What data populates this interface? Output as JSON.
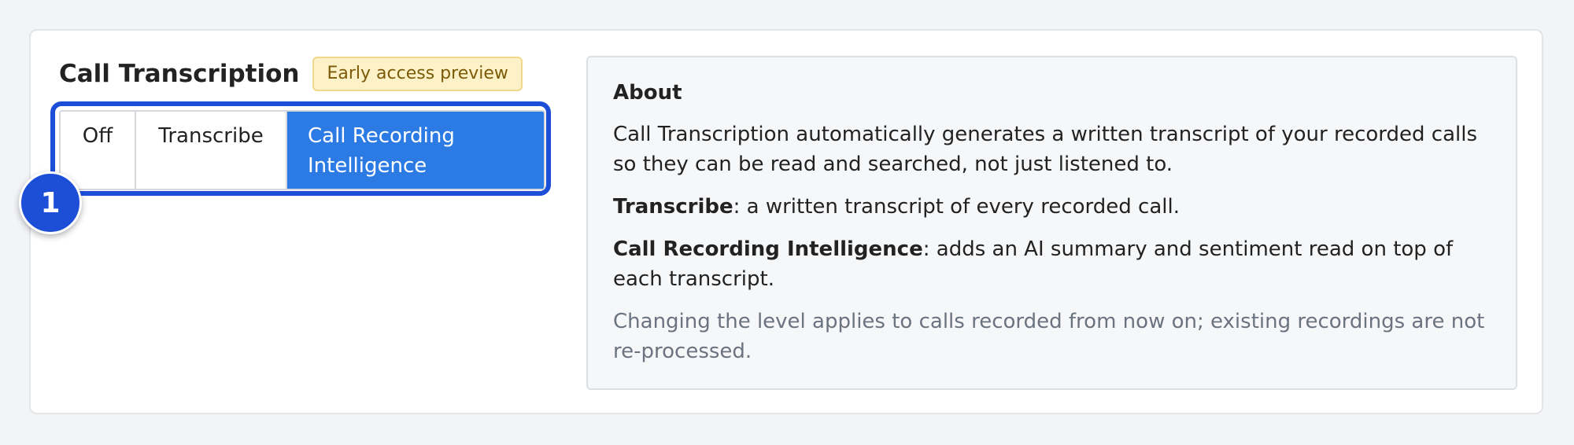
{
  "header": {
    "title": "Call Transcription",
    "badge": "Early access preview"
  },
  "segmented_control": {
    "options": [
      {
        "label": "Off",
        "selected": false
      },
      {
        "label": "Transcribe",
        "selected": false
      },
      {
        "label": "Call Recording Intelligence",
        "selected": true
      }
    ],
    "step_marker": "1"
  },
  "about": {
    "heading": "About",
    "intro": "Call Transcription automatically generates a written transcript of your recorded calls so they can be read and searched, not just listened to.",
    "transcribe_term": "Transcribe",
    "transcribe_desc": ": a written transcript of every recorded call.",
    "cri_term": "Call Recording Intelligence",
    "cri_desc": ": adds an AI summary and sentiment read on top of each transcript.",
    "note": "Changing the level applies to calls recorded from now on; existing recordings are not re-processed."
  },
  "colors": {
    "accent": "#2c7be5",
    "highlight": "#1d4ed8",
    "badge_bg": "#fdf1c7",
    "badge_text": "#7a5b07",
    "muted_text": "#6b7280"
  }
}
